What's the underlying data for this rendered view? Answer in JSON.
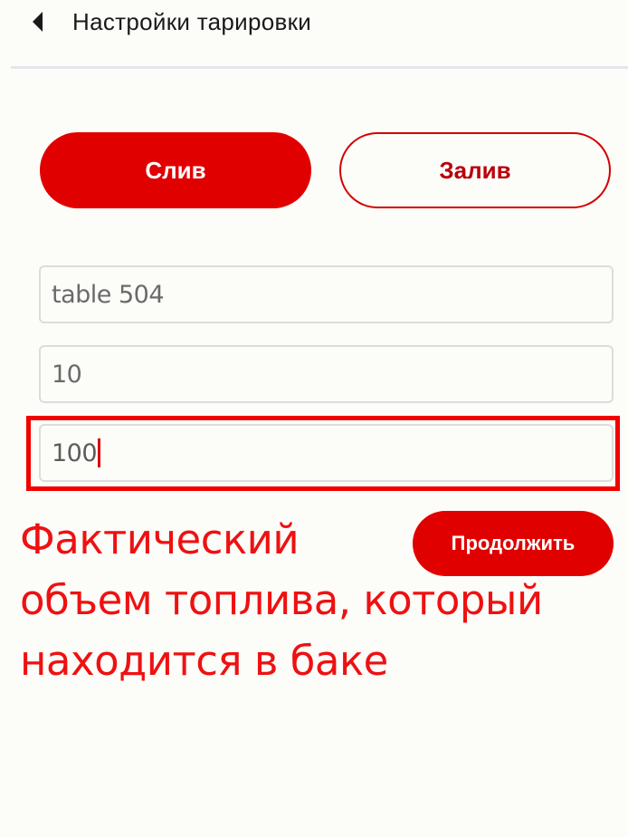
{
  "header": {
    "title": "Настройки тарировки"
  },
  "mode_toggle": {
    "drain_label": "Слив",
    "fill_label": "Залив"
  },
  "form": {
    "fields": [
      {
        "value": "table 504"
      },
      {
        "value": "10"
      },
      {
        "value": "100"
      }
    ]
  },
  "actions": {
    "continue_label": "Продолжить"
  },
  "annotation": {
    "lines": [
      "Фактический",
      "объем топлива, который",
      "находится в баке"
    ]
  },
  "colors": {
    "accent": "#e00000",
    "annotation": "#ee1111",
    "highlight": "#f20000",
    "background": "#fcfcf9"
  },
  "icons": {
    "back": "back-arrow-icon"
  }
}
